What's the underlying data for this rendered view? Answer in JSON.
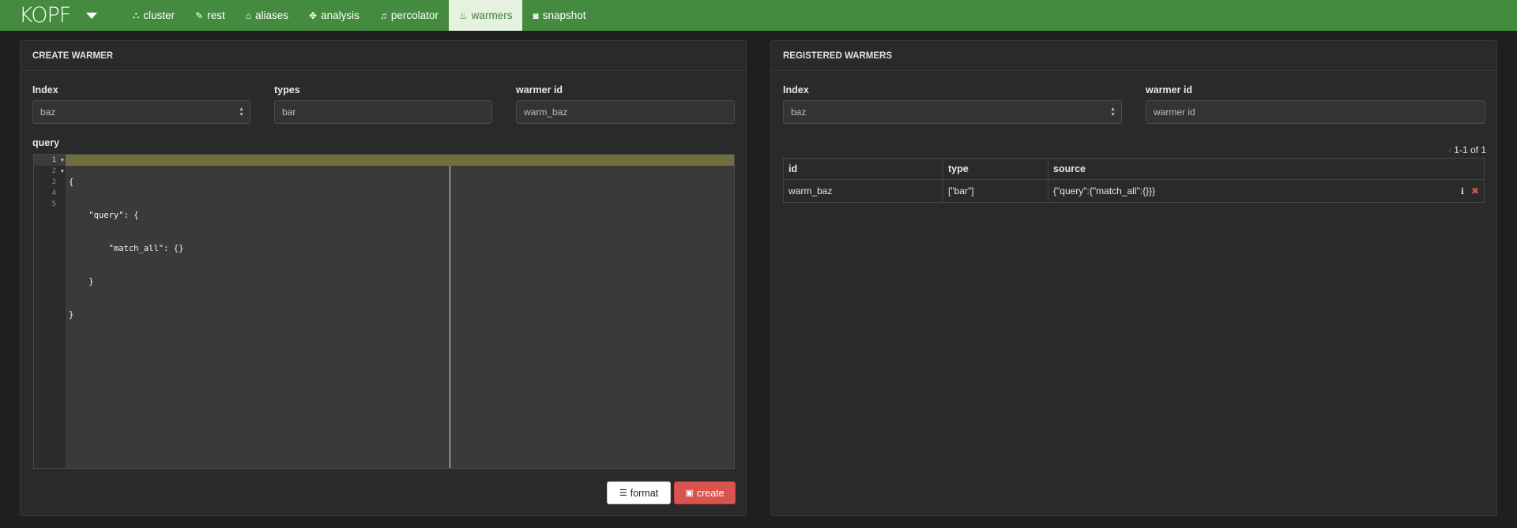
{
  "nav": {
    "brand": "KOPF",
    "items": [
      {
        "label": "cluster",
        "icon": "sitemap-icon",
        "glyph": "⛬"
      },
      {
        "label": "rest",
        "icon": "edit-icon",
        "glyph": "✎"
      },
      {
        "label": "aliases",
        "icon": "tags-icon",
        "glyph": "⌂"
      },
      {
        "label": "analysis",
        "icon": "puzzle-icon",
        "glyph": "✥"
      },
      {
        "label": "percolator",
        "icon": "bell-icon",
        "glyph": "♫"
      },
      {
        "label": "warmers",
        "icon": "fire-icon",
        "glyph": "♨"
      },
      {
        "label": "snapshot",
        "icon": "camera-icon",
        "glyph": "◙"
      }
    ],
    "active": "warmers"
  },
  "create": {
    "title": "CREATE WARMER",
    "index_label": "Index",
    "index_value": "baz",
    "types_label": "types",
    "types_value": "bar",
    "warmer_id_label": "warmer id",
    "warmer_id_value": "warm_baz",
    "query_label": "query",
    "query_lines": [
      "{",
      "    \"query\": {",
      "        \"match_all\": {}",
      "    }",
      "}"
    ],
    "line_numbers": [
      "1",
      "2",
      "3",
      "4",
      "5"
    ],
    "format_label": "format",
    "create_label": "create"
  },
  "registered": {
    "title": "REGISTERED WARMERS",
    "index_label": "Index",
    "index_value": "baz",
    "warmer_id_label": "warmer id",
    "warmer_id_placeholder": "warmer id",
    "pager": "1-1 of 1",
    "columns": [
      "id",
      "type",
      "source"
    ],
    "rows": [
      {
        "id": "warm_baz",
        "type": "[\"bar\"]",
        "source": "{\"query\":{\"match_all\":{}}}"
      }
    ]
  },
  "colors": {
    "navbar": "#458b3f",
    "active_tab_bg": "#e5f2df",
    "danger": "#d9534f"
  }
}
